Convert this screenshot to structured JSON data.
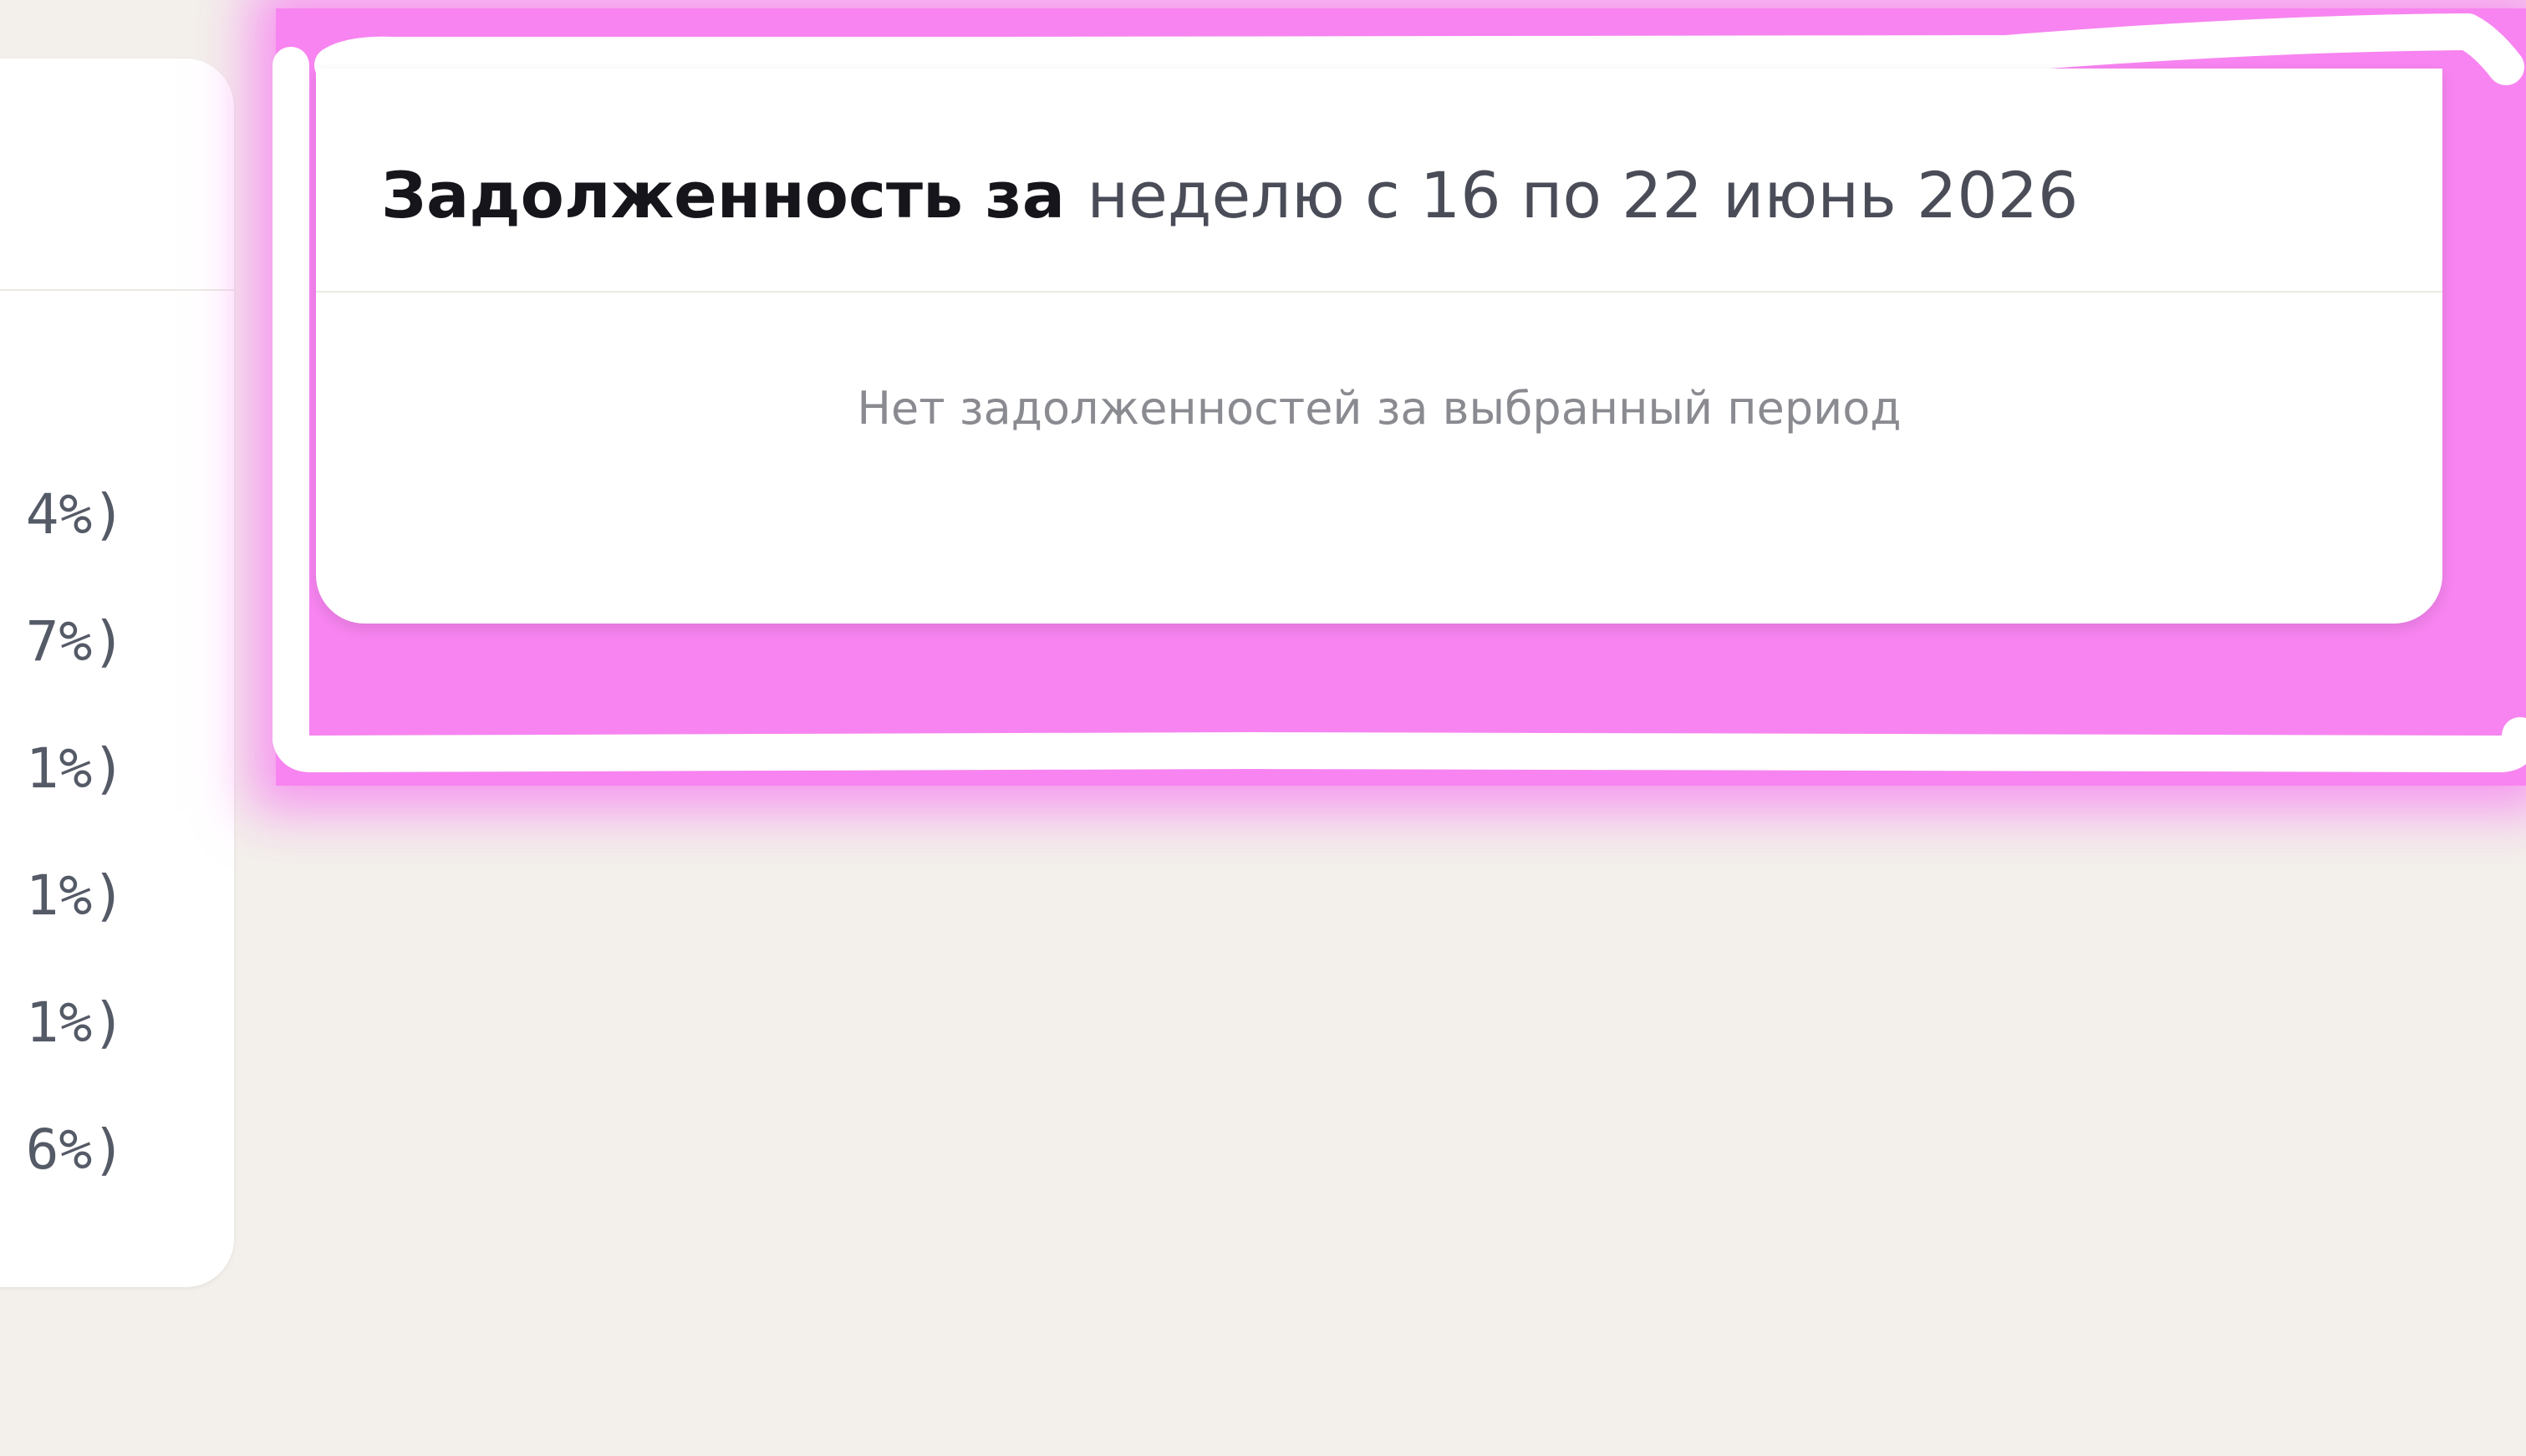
{
  "left_card": {
    "percentages": [
      "4%)",
      "7%)",
      "1%)",
      "1%)",
      "1%)",
      "6%)"
    ]
  },
  "debt_card": {
    "title_strong": "Задолженность за",
    "title_period": "неделю с 16 по 22 июнь 2026",
    "empty_message": "Нет задолженностей за выбранный период"
  },
  "colors": {
    "page_background": "#f3f0eb",
    "highlight": "#f784f0",
    "card_background": "#ffffff"
  }
}
